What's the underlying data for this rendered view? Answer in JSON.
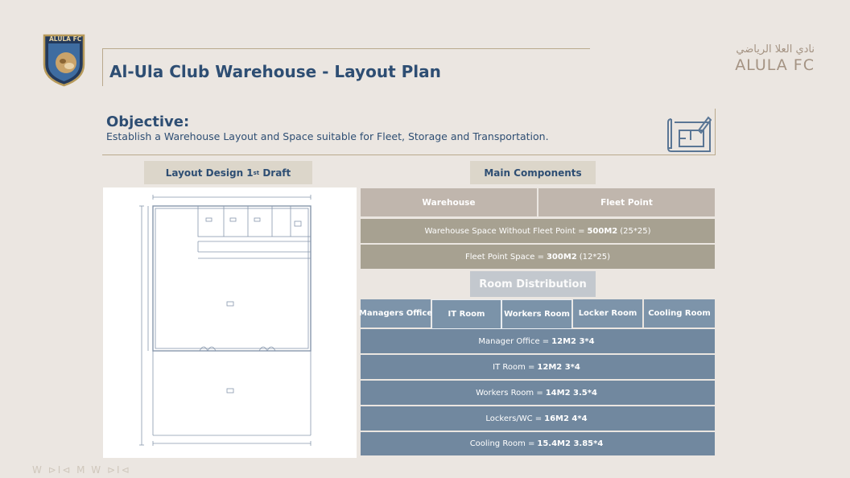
{
  "crest": {
    "text": "ALULA FC",
    "icon": "club-crest-icon"
  },
  "brand": {
    "arabic": "نادي العلا الرياضي",
    "english": "ALULA FC"
  },
  "title": "Al-Ula Club Warehouse - Layout Plan",
  "objective": {
    "heading": "Objective:",
    "text": "Establish a Warehouse Layout and Space suitable for Fleet, Storage and Transportation.",
    "icon": "blueprint-icon"
  },
  "layout_label": {
    "prefix": "Layout Design 1",
    "sup": "st",
    "suffix": " Draft"
  },
  "main_components": {
    "label": "Main Components",
    "headers": [
      "Warehouse",
      "Fleet Point"
    ],
    "rows": [
      {
        "pre": "Warehouse Space Without Fleet Point =",
        "bold": "500M2",
        "post": "(25*25)"
      },
      {
        "pre": "Fleet Point Space =",
        "bold": "300M2",
        "post": "(12*25)"
      }
    ]
  },
  "room_distribution": {
    "label": "Room Distribution",
    "headers": [
      "Managers Office",
      "IT Room",
      "Workers Room",
      "Locker Room",
      "Cooling Room"
    ],
    "rows": [
      {
        "pre": "Manager Office =",
        "bold": "12M2 3*4",
        "post": ""
      },
      {
        "pre": "IT Room =",
        "bold": "12M2 3*4",
        "post": ""
      },
      {
        "pre": "Workers Room =",
        "bold": "14M2 3.5*4",
        "post": ""
      },
      {
        "pre": "Lockers/WC =",
        "bold": "16M2 4*4",
        "post": ""
      },
      {
        "pre": "Cooling Room =",
        "bold": "15.4M2 3.85*4",
        "post": ""
      }
    ]
  },
  "footer": "W ⊳I⊲ M W ⊳I⊲",
  "colors": {
    "navy": "#2e4e73",
    "gold": "#b9a98c",
    "room_row": "#71889f",
    "component_row": "#a7a191"
  }
}
